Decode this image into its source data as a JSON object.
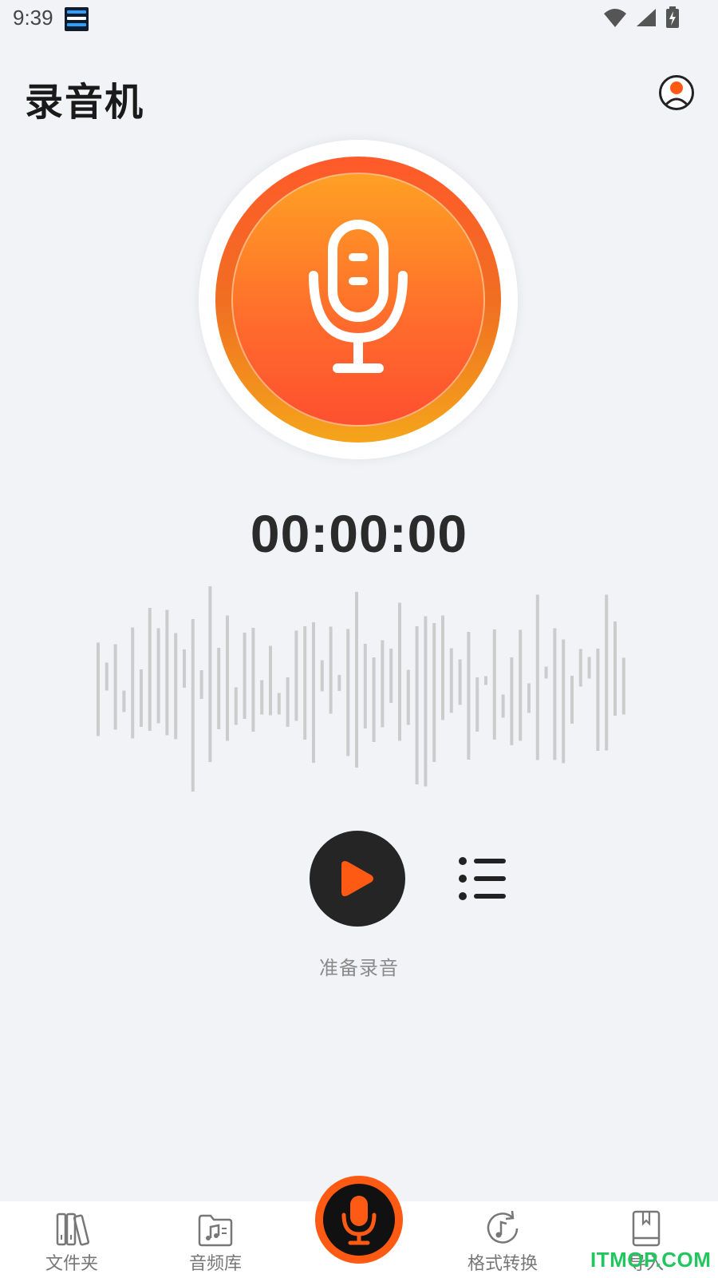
{
  "status_bar": {
    "time": "9:39"
  },
  "header": {
    "title": "录音机"
  },
  "recorder": {
    "timer": "00:00:00",
    "status_label": "准备录音"
  },
  "tabs": [
    {
      "label": "文件夹",
      "icon": "folder-books-icon"
    },
    {
      "label": "音频库",
      "icon": "audio-library-icon"
    },
    {
      "label": "",
      "icon": "microphone-icon"
    },
    {
      "label": "格式转换",
      "icon": "format-convert-icon"
    },
    {
      "label": "导入",
      "icon": "import-book-icon"
    }
  ],
  "watermark": "ITMOP.COM",
  "colors": {
    "accent": "#FF5A14",
    "accent_gradient_top": "#FFA024",
    "accent_gradient_bottom": "#FF5030",
    "dark_button": "#252525",
    "background": "#F2F3F7",
    "waveform": "#C4C4C4"
  }
}
